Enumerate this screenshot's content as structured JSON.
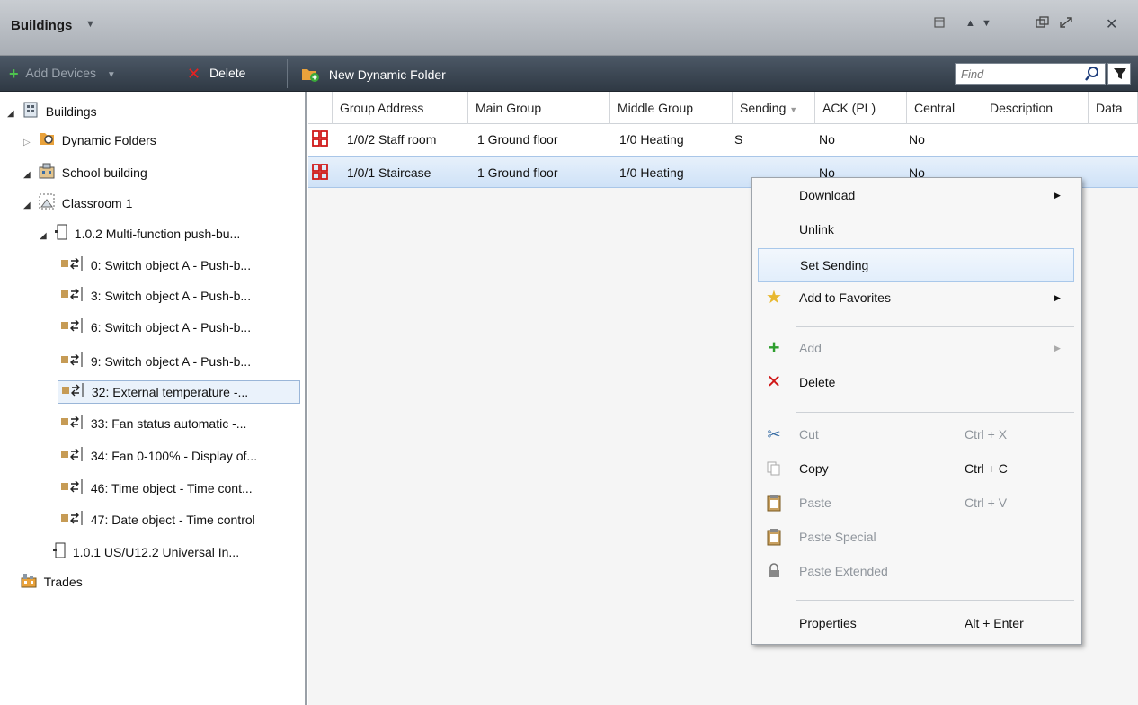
{
  "window": {
    "title": "Buildings",
    "controls": [
      "restore-icon",
      "up-icon",
      "down-icon",
      "float-icon",
      "maximize-icon",
      "close-icon"
    ]
  },
  "toolbar": {
    "add_devices_label": "Add Devices",
    "delete_label": "Delete",
    "new_dynamic_folder_label": "New Dynamic Folder",
    "find_placeholder": "Find"
  },
  "tree": {
    "items": [
      {
        "label": "Buildings"
      },
      {
        "label": "Dynamic Folders"
      },
      {
        "label": "School building"
      },
      {
        "label": "Classroom 1"
      },
      {
        "label": "1.0.2  Multi-function push-bu..."
      },
      {
        "label": "0: Switch object A - Push-b..."
      },
      {
        "label": "3: Switch object A - Push-b..."
      },
      {
        "label": "6: Switch object A - Push-b..."
      },
      {
        "label": "9: Switch object A - Push-b..."
      },
      {
        "label": "32: External temperature -..."
      },
      {
        "label": "33: Fan status automatic -..."
      },
      {
        "label": "34: Fan 0-100% - Display of..."
      },
      {
        "label": "46: Time object - Time cont..."
      },
      {
        "label": "47: Date object - Time control"
      },
      {
        "label": "1.0.1  US/U12.2 Universal In..."
      },
      {
        "label": "Trades"
      }
    ]
  },
  "grid": {
    "columns": [
      "Group Address",
      "Main Group",
      "Middle Group",
      "Sending",
      "ACK (PL)",
      "Central",
      "Description",
      "Data"
    ],
    "rows": [
      {
        "group_address": "1/0/2 Staff room",
        "main_group": "1 Ground floor",
        "middle_group": "1/0 Heating",
        "sending": "S",
        "ack": "No",
        "central": "No"
      },
      {
        "group_address": "1/0/1 Staircase",
        "main_group": "1 Ground floor",
        "middle_group": "1/0 Heating",
        "sending": "",
        "ack": "No",
        "central": "No"
      }
    ]
  },
  "context_menu": {
    "download": "Download",
    "unlink": "Unlink",
    "set_sending": "Set Sending",
    "add_to_favorites": "Add to Favorites",
    "add": "Add",
    "delete": "Delete",
    "cut": "Cut",
    "cut_shortcut": "Ctrl + X",
    "copy": "Copy",
    "copy_shortcut": "Ctrl + C",
    "paste": "Paste",
    "paste_shortcut": "Ctrl + V",
    "paste_special": "Paste Special",
    "paste_extended": "Paste Extended",
    "properties": "Properties",
    "properties_shortcut": "Alt + Enter"
  },
  "colors": {
    "toolbar_bg": "#2f3944",
    "selection": "#cfe2f7",
    "accent_green": "#2e9e2e",
    "delete_red": "#d01818"
  }
}
